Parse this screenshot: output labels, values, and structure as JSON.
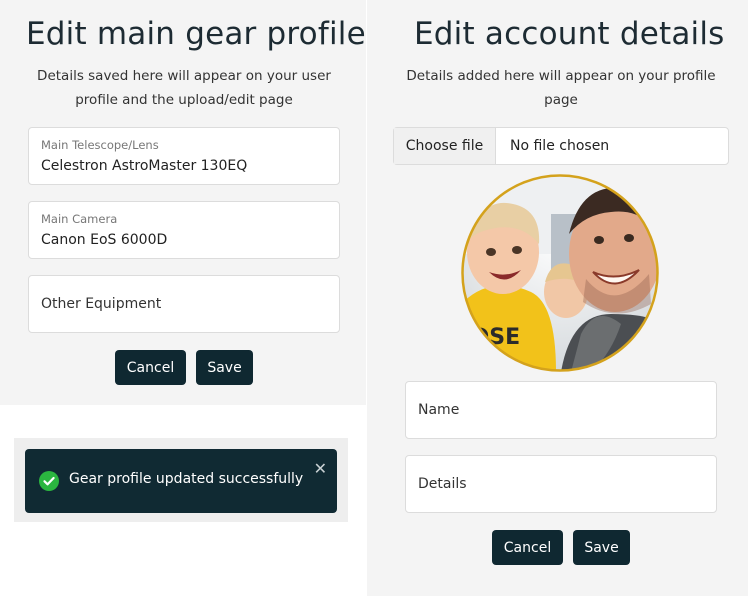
{
  "gear": {
    "title": "Edit main gear profile",
    "subtitle": "Details saved here will appear on your user profile and the upload/edit page",
    "telescope": {
      "label": "Main Telescope/Lens",
      "value": "Celestron AstroMaster 130EQ"
    },
    "camera": {
      "label": "Main Camera",
      "value": "Canon EoS 6000D"
    },
    "other": {
      "placeholder": "Other Equipment"
    },
    "cancel_label": "Cancel",
    "save_label": "Save"
  },
  "toast": {
    "message": "Gear profile updated successfully",
    "close_glyph": "✕"
  },
  "account": {
    "title": "Edit account details",
    "subtitle": "Details added here will appear on your profile page",
    "file": {
      "button_label": "Choose file",
      "status": "No file chosen"
    },
    "name": {
      "placeholder": "Name"
    },
    "details": {
      "placeholder": "Details"
    },
    "cancel_label": "Cancel",
    "save_label": "Save"
  },
  "icons": {
    "success": "check-circle-icon",
    "close": "close-icon",
    "avatar": "profile-photo"
  },
  "colors": {
    "panel_bg": "#f4f4f4",
    "button_bg": "#0f2831",
    "toast_bg": "#102a33",
    "success_green": "#2bb640",
    "avatar_ring": "#d4a21c"
  }
}
